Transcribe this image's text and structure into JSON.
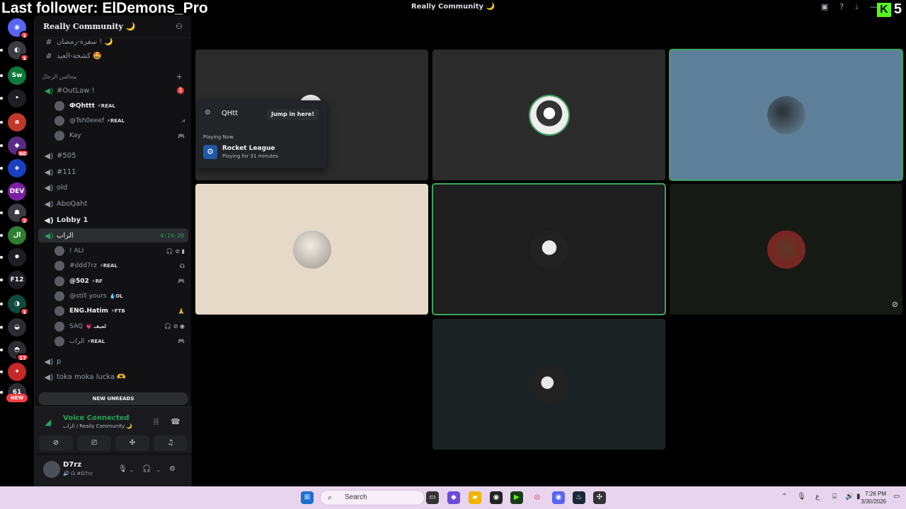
{
  "overlay": {
    "title": "Last follower: ElDemons_Pro",
    "kick_count": "5",
    "kick_logo": "K"
  },
  "titlebar": {
    "title": "Really Community 🌙"
  },
  "rail": {
    "servers": [
      {
        "label": "◉",
        "color": "#5865f2",
        "badge": "1"
      },
      {
        "label": "◐",
        "color": "#3a3c42",
        "badge": "1"
      },
      {
        "label": "Sw",
        "color": "#0e7a3a",
        "badge": ""
      },
      {
        "label": "•",
        "color": "#1e1f22",
        "badge": ""
      },
      {
        "label": "a",
        "color": "#c0392b",
        "badge": ""
      },
      {
        "label": "◆",
        "color": "#5b2a86",
        "badge": "60"
      },
      {
        "label": "◈",
        "color": "#1a3fbf",
        "badge": ""
      },
      {
        "label": "DEV",
        "color": "#7a1fa2",
        "badge": ""
      },
      {
        "label": "☗",
        "color": "#3a3c42",
        "badge": "2"
      },
      {
        "label": "ال",
        "color": "#2e7d32",
        "badge": ""
      },
      {
        "label": "✹",
        "color": "#1e1f22",
        "badge": ""
      },
      {
        "label": "F12",
        "color": "#1e1f22",
        "badge": ""
      },
      {
        "label": "◑",
        "color": "#104a3a",
        "badge": "1"
      },
      {
        "label": "◒",
        "color": "#2b2d31",
        "badge": ""
      },
      {
        "label": "◓",
        "color": "#2b2d31",
        "badge": "17"
      },
      {
        "label": "✦",
        "color": "#c62828",
        "badge": ""
      },
      {
        "label": "61",
        "color": "#2b2d31",
        "badge": ""
      }
    ],
    "new_label": "NEW"
  },
  "sidebar": {
    "guild_name": "Really Community 🌙",
    "top_channels": [
      {
        "name": "سفرة-رمضان ! 🌙"
      },
      {
        "name": "كشخة-العيد 🤩"
      }
    ],
    "category": "مجالس الرجال",
    "voice_channels": {
      "outlaw": {
        "name": "#OutLaw !",
        "unread": "1"
      },
      "c505": "#505",
      "c111": "#111",
      "old": "old",
      "aboqaht": "AboQaht",
      "lobby": "Lobby 1",
      "alrab": {
        "name": "الراب",
        "timer": "4:14:20"
      },
      "p": "p",
      "toka": "toka moka lucka 🫶"
    },
    "outlaw_members": [
      {
        "name": "ФQhttt",
        "tag": "⚡REAL",
        "right": "",
        "bright": true
      },
      {
        "name": "@Tsh0eeef",
        "tag": "⚡REAL",
        "right": "⩘",
        "bright": false
      },
      {
        "name": "Kay",
        "tag": "",
        "right": "🎮",
        "bright": false
      }
    ],
    "alrab_members": [
      {
        "name": "! ALI",
        "tag": "",
        "right": "🎧 ⊘ ▮",
        "bright": false
      },
      {
        "name": "#ddd7rz",
        "tag": "⚡REAL",
        "right": "☊",
        "bright": false
      },
      {
        "name": "@502",
        "tag": "⚡RF",
        "right": "🎮",
        "bright": true
      },
      {
        "name": "@still yours",
        "tag": "💧OL",
        "right": "",
        "bright": false
      },
      {
        "name": "ENG.Hatim",
        "tag": "⚡FTB",
        "right": "🙏",
        "bright": true
      },
      {
        "name": "SAQ",
        "tag": "💗 لعيف",
        "right": "🎧 ⊘ ◉",
        "bright": false
      },
      {
        "name": "الراب",
        "tag": "⚡REAL",
        "right": "🎮",
        "bright": false
      }
    ],
    "new_unreads": "NEW UNREADS"
  },
  "voice_panel": {
    "status": "Voice Connected",
    "location": "الراب / Really Community 🌙"
  },
  "user_panel": {
    "name": "D7rz",
    "status": "🔊 ☊ #D7rz"
  },
  "popup": {
    "name": "QHtt",
    "jump_label": "Jump in here!",
    "playing_label": "Playing Now",
    "game": "Rocket League",
    "duration": "Playing for 31 minutes"
  },
  "taskbar": {
    "search_placeholder": "Search",
    "time": "7:26 PM",
    "date": "3/30/2026",
    "lang": "ع"
  },
  "colors": {
    "accent": "#5865f2",
    "green": "#23a55a",
    "red": "#f23f43",
    "speaking": "#3ba55d"
  }
}
